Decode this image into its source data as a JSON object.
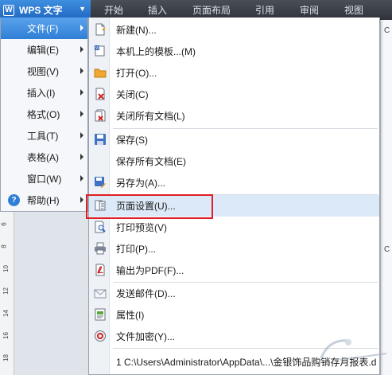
{
  "app": {
    "title": "WPS 文字",
    "logo_letter": "W"
  },
  "ribbon": {
    "tabs": [
      "开始",
      "插入",
      "页面布局",
      "引用",
      "审阅",
      "视图"
    ]
  },
  "main_menu": [
    {
      "label": "文件(F)",
      "active": true
    },
    {
      "label": "编辑(E)"
    },
    {
      "label": "视图(V)"
    },
    {
      "label": "插入(I)"
    },
    {
      "label": "格式(O)"
    },
    {
      "label": "工具(T)"
    },
    {
      "label": "表格(A)"
    },
    {
      "label": "窗口(W)"
    },
    {
      "label": "帮助(H)",
      "icon": "help-icon"
    }
  ],
  "file_menu": [
    {
      "label": "新建(N)...",
      "icon": "new-document-icon"
    },
    {
      "label": "本机上的模板...(M)",
      "icon": "template-icon"
    },
    {
      "label": "打开(O)...",
      "icon": "open-folder-icon"
    },
    {
      "label": "关闭(C)",
      "icon": "close-document-icon"
    },
    {
      "label": "关闭所有文档(L)",
      "icon": "close-all-documents-icon"
    },
    {
      "label": "保存(S)",
      "icon": "save-icon"
    },
    {
      "label": "保存所有文档(E)",
      "icon": ""
    },
    {
      "label": "另存为(A)...",
      "icon": "save-as-icon"
    },
    {
      "label": "页面设置(U)...",
      "icon": "page-setup-icon",
      "highlighted": true
    },
    {
      "label": "打印预览(V)",
      "icon": "print-preview-icon"
    },
    {
      "label": "打印(P)...",
      "icon": "print-icon"
    },
    {
      "label": "输出为PDF(F)...",
      "icon": "pdf-export-icon"
    },
    {
      "label": "发送邮件(D)...",
      "icon": "mail-icon"
    },
    {
      "label": "属性(I)",
      "icon": "properties-icon"
    },
    {
      "label": "文件加密(Y)...",
      "icon": "encrypt-icon"
    },
    {
      "label": "1 C:\\Users\\Administrator\\AppData\\...\\金银饰品购销存月报表.d",
      "icon": ""
    }
  ],
  "ruler": {
    "numbers": [
      "6",
      "8",
      "10",
      "12",
      "14",
      "16",
      "18"
    ]
  },
  "side_menu": {
    "letters": [
      "C",
      "C"
    ]
  },
  "colors": {
    "highlight_box": "#e01e25",
    "accent": "#2f7fd6"
  }
}
